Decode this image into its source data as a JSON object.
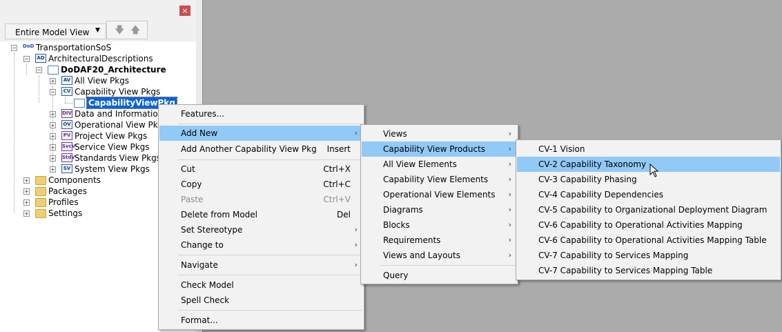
{
  "panel": {
    "close_glyph": "×",
    "view_dropdown": "Entire Model View",
    "down_glyph": "🡇",
    "up_glyph": "🡅"
  },
  "tree": [
    {
      "label": "TransportationSoS",
      "icon": "dod-icon",
      "badge": "DoD"
    },
    {
      "label": "ArchitecturalDescriptions",
      "icon": "ad-icon",
      "badge": "AD"
    },
    {
      "label": "DoDAF20_Architecture",
      "icon": "folder-open-icon",
      "badge": ""
    },
    {
      "label": "All View Pkgs",
      "icon": "av-icon",
      "badge": "AV"
    },
    {
      "label": "Capability View Pkgs",
      "icon": "cv-icon",
      "badge": "CV"
    },
    {
      "label": "CapabilityViewPkg",
      "icon": "folder-open-icon",
      "badge": ""
    },
    {
      "label": "Data and Information V",
      "icon": "div-icon",
      "badge": "DIV"
    },
    {
      "label": "Operational View Pkgs",
      "icon": "ov-icon",
      "badge": "OV"
    },
    {
      "label": "Project View Pkgs",
      "icon": "pv-icon",
      "badge": "PV"
    },
    {
      "label": "Service View Pkgs",
      "icon": "svcv-icon",
      "badge": "SvcV"
    },
    {
      "label": "Standards View Pkgs",
      "icon": "stdv-icon",
      "badge": "StdV"
    },
    {
      "label": "System View Pkgs",
      "icon": "sv-icon",
      "badge": "SV"
    },
    {
      "label": "Components",
      "icon": "folder-icon",
      "badge": ""
    },
    {
      "label": "Packages",
      "icon": "folder-icon",
      "badge": ""
    },
    {
      "label": "Profiles",
      "icon": "folder-icon",
      "badge": ""
    },
    {
      "label": "Settings",
      "icon": "folder-icon",
      "badge": ""
    }
  ],
  "menu1": [
    {
      "label": "Features...",
      "key": ""
    },
    {
      "label": "Add New",
      "key": "",
      "sub": true,
      "hl": true
    },
    {
      "label": "Add Another Capability View Pkg",
      "key": "Insert"
    },
    {
      "label": "Cut",
      "key": "Ctrl+X"
    },
    {
      "label": "Copy",
      "key": "Ctrl+C"
    },
    {
      "label": "Paste",
      "key": "Ctrl+V",
      "disabled": true
    },
    {
      "label": "Delete from Model",
      "key": "Del"
    },
    {
      "label": "Set Stereotype",
      "key": "",
      "sub": true
    },
    {
      "label": "Change to",
      "key": "",
      "sub": true
    },
    {
      "label": "Navigate",
      "key": "",
      "sub": true
    },
    {
      "label": "Check Model",
      "key": ""
    },
    {
      "label": "Spell Check",
      "key": ""
    },
    {
      "label": "Format...",
      "key": ""
    }
  ],
  "menu2": [
    {
      "label": "Views",
      "sub": true
    },
    {
      "label": "Capability View Products",
      "sub": true,
      "hl": true
    },
    {
      "label": "All View Elements",
      "sub": true
    },
    {
      "label": "Capability View Elements",
      "sub": true
    },
    {
      "label": "Operational View Elements",
      "sub": true
    },
    {
      "label": "Diagrams",
      "sub": true
    },
    {
      "label": "Blocks",
      "sub": true
    },
    {
      "label": "Requirements",
      "sub": true
    },
    {
      "label": "Views and Layouts",
      "sub": true
    },
    {
      "label": "Query",
      "sub": false
    }
  ],
  "menu3": [
    {
      "label": "CV-1 Vision"
    },
    {
      "label": "CV-2 Capability Taxonomy",
      "hl": true
    },
    {
      "label": "CV-3 Capability Phasing"
    },
    {
      "label": "CV-4 Capability Dependencies"
    },
    {
      "label": "CV-5 Capability to Organizational Deployment Diagram"
    },
    {
      "label": "CV-6 Capability to Operational Activities Mapping"
    },
    {
      "label": "CV-6 Capability to Operational Activities Mapping Table"
    },
    {
      "label": "CV-7 Capability to Services Mapping"
    },
    {
      "label": "CV-7 Capability to Services Mapping Table"
    }
  ],
  "submenu_arrow": "›",
  "colors": {
    "highlight": "#91c9f7",
    "selected_node": "#0a64d6",
    "canvas": "#ababab"
  }
}
